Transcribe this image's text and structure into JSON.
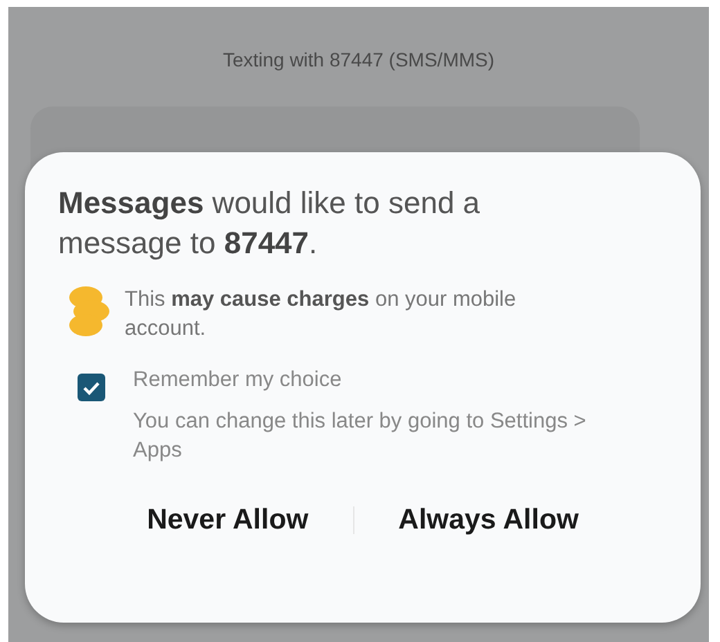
{
  "header": {
    "title": "Texting with 87447 (SMS/MMS)"
  },
  "dialog": {
    "title": "**Messages** would like to send a message to **87447**.",
    "warning": "This **may cause charges** on your mobile account.",
    "remember": {
      "label": "Remember my choice",
      "checked": true
    },
    "hint": "You can change this later by going to Settings > Apps",
    "buttons": [
      {
        "label": "Never Allow"
      },
      {
        "label": "Always Allow"
      }
    ]
  }
}
